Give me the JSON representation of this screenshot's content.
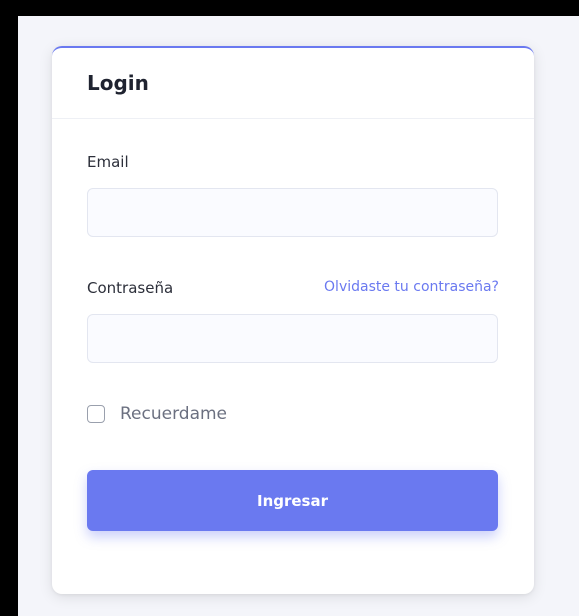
{
  "login_card": {
    "title": "Login",
    "email": {
      "label": "Email",
      "value": "",
      "placeholder": ""
    },
    "password": {
      "label": "Contraseña",
      "value": "",
      "placeholder": "",
      "forgot_link": "Olvidaste tu contraseña?"
    },
    "remember": {
      "label": "Recuerdame",
      "checked": false
    },
    "submit_label": "Ingresar"
  },
  "colors": {
    "accent": "#6a79f0",
    "page_background": "#f4f5fa",
    "card_background": "#ffffff",
    "frame": "#000000"
  }
}
